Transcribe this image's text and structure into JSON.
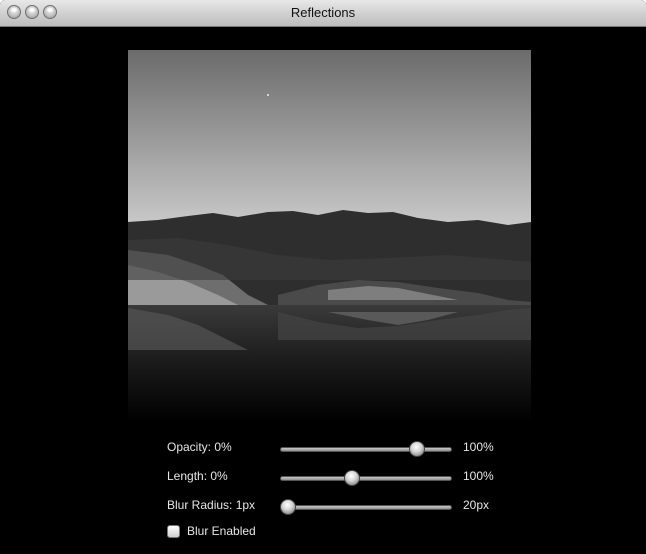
{
  "window": {
    "title": "Reflections"
  },
  "photo": {
    "description_icon": "landscape-photo"
  },
  "controls": {
    "opacity": {
      "label": "Opacity: 0%",
      "max_label": "100%",
      "value_fraction": 0.83
    },
    "length": {
      "label": "Length: 0%",
      "max_label": "100%",
      "value_fraction": 0.41
    },
    "blur_radius": {
      "label": "Blur Radius: 1px",
      "max_label": "20px",
      "value_fraction": 0.0
    },
    "blur_enabled": {
      "label": "Blur Enabled",
      "checked": false
    }
  }
}
